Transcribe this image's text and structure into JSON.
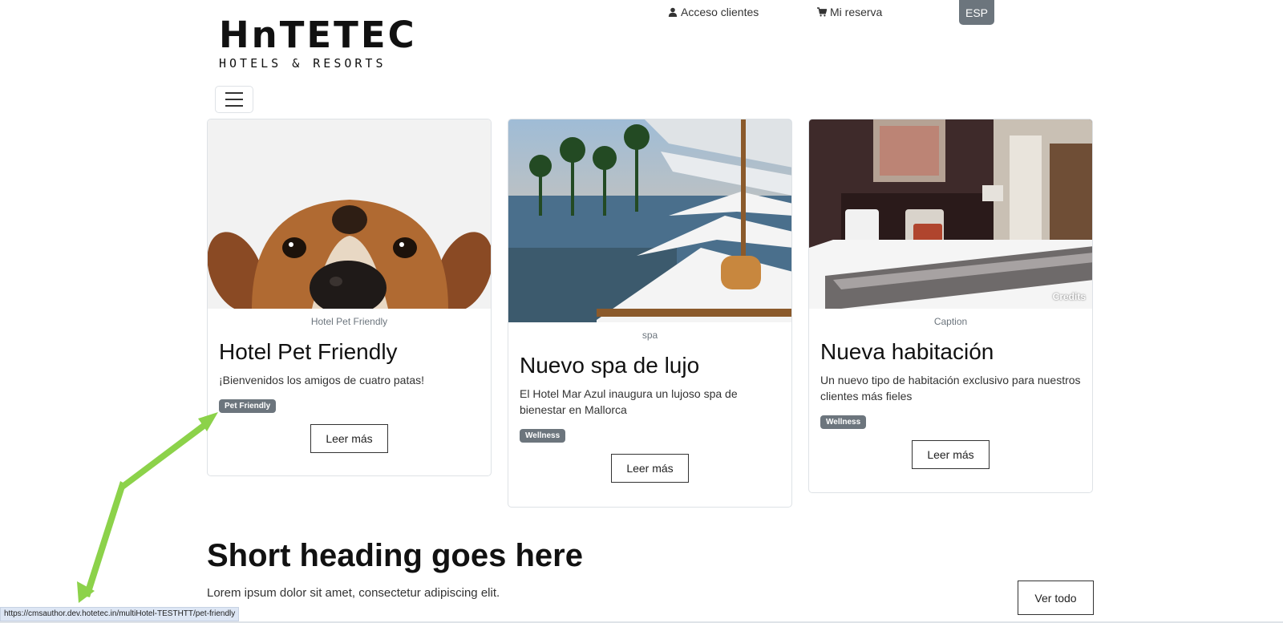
{
  "header": {
    "logo_main": "HnTETEC",
    "logo_sub": "HOTELS & RESORTS",
    "account_link": "Acceso clientes",
    "booking_link": "Mi reserva",
    "language": "ESP",
    "icons": {
      "account": "user-icon",
      "booking": "cart-icon",
      "menu": "hamburger-menu-icon"
    }
  },
  "cards": [
    {
      "image": "dog-peeking-image",
      "caption": "Hotel Pet Friendly",
      "title": "Hotel Pet Friendly",
      "text": "¡Bienvenidos los amigos de cuatro patas!",
      "badge": "Pet Friendly",
      "button": "Leer más"
    },
    {
      "image": "pool-sunbeds-image",
      "caption": "spa",
      "title": "Nuevo spa de lujo",
      "text": "El Hotel Mar Azul inaugura un lujoso spa de bienestar en Mallorca",
      "badge": "Wellness",
      "button": "Leer más"
    },
    {
      "image": "hotel-room-bed-image",
      "caption": "Caption",
      "title": "Nueva habitación",
      "text": "Un nuevo tipo de habitación exclusivo para nuestros clientes más fieles",
      "badge": "Wellness",
      "button": "Leer más",
      "credits": "Credits"
    }
  ],
  "section": {
    "heading": "Short heading goes here",
    "text": "Lorem ipsum dolor sit amet, consectetur adipiscing elit.",
    "button": "Ver todo"
  },
  "status_bar": {
    "url": "https://cmsauthor.dev.hotetec.in/multiHotel-TESTHTT/pet-friendly"
  },
  "colors": {
    "badge": "#6c757d",
    "lang_button": "#6c757d",
    "annotation_arrow": "#8cd24a",
    "status_bar": "#dde6f4"
  }
}
